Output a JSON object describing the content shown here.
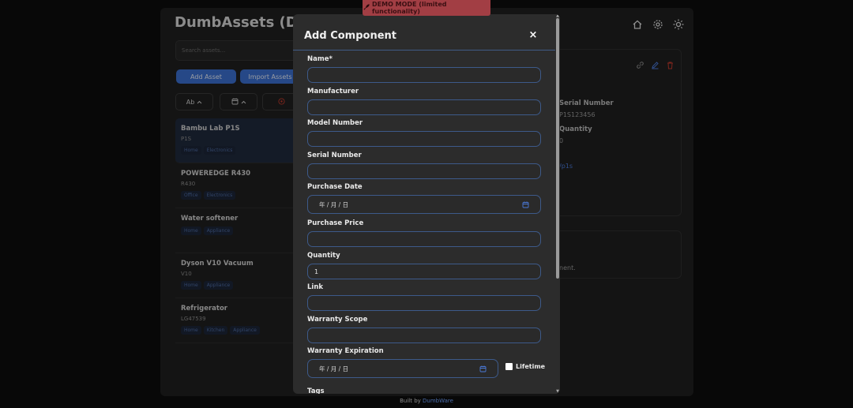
{
  "banner": {
    "text": "DEMO MODE (limited functionality)"
  },
  "app": {
    "title": "DumbAssets (DEM"
  },
  "search": {
    "placeholder": "Search assets..."
  },
  "buttons": {
    "add_asset": "Add Asset",
    "import_assets": "Import Assets"
  },
  "sort": {
    "name_label": "Ab"
  },
  "assets": [
    {
      "name": "Bambu Lab P1S",
      "model": "P1S",
      "tags": [
        "Home",
        "Electronics"
      ],
      "selected": true,
      "status": "#c0392b"
    },
    {
      "name": "POWEREDGE R430",
      "model": "R430",
      "tags": [
        "Office",
        "Electronics"
      ],
      "status": "#d4a017"
    },
    {
      "name": "Water softener",
      "model": "",
      "tags": [
        "Home",
        "Appliance"
      ]
    },
    {
      "name": "Dyson V10 Vacuum",
      "model": "V10",
      "tags": [
        "Home",
        "Appliance"
      ]
    },
    {
      "name": "Refrigerator",
      "model": "LG47539",
      "tags": [
        "Home",
        "Kitchen",
        "Appliance"
      ],
      "status": "#c0392b"
    }
  ],
  "detail": {
    "serial_label": "Serial Number",
    "serial_value": "P1S123456",
    "quantity_label": "Quantity",
    "quantity_value": "0",
    "link_partial": "/p1s",
    "component_partial": "nent."
  },
  "modal": {
    "title": "Add Component",
    "close": "×",
    "fields": {
      "name": "Name*",
      "manufacturer": "Manufacturer",
      "model": "Model Number",
      "serial": "Serial Number",
      "purchase_date": "Purchase Date",
      "purchase_date_value": "年 / 月 / 日",
      "purchase_price": "Purchase Price",
      "quantity": "Quantity",
      "quantity_value": "1",
      "link": "Link",
      "warranty_scope": "Warranty Scope",
      "warranty_expiration": "Warranty Expiration",
      "warranty_expiration_value": "年 / 月 / 日",
      "lifetime": "Lifetime",
      "tags": "Tags"
    }
  },
  "footer": {
    "prefix": "Built by ",
    "link": "DumbWare"
  },
  "colors": {
    "accent": "#3b6fcf",
    "banner": "#a23e44",
    "danger": "#c0392b"
  }
}
